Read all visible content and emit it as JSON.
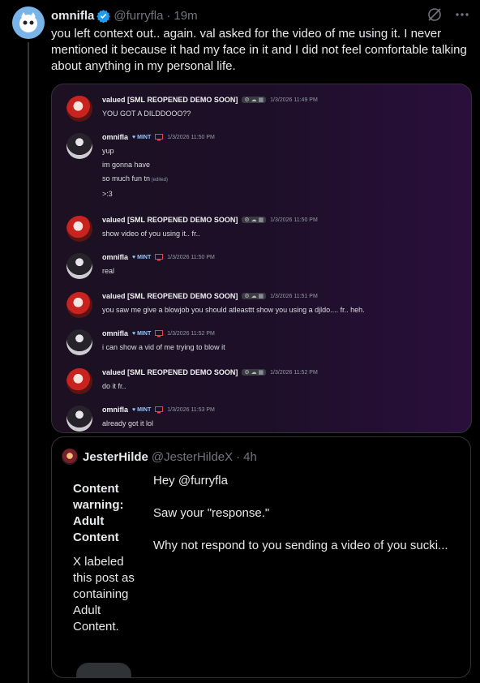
{
  "post": {
    "display_name": "omnifla",
    "handle": "@furryfla",
    "separator": "·",
    "time": "19m",
    "text": "you left context out.. again. val asked for the video of me using it. I never mentioned it because it had my face in it and I did not feel comfortable talking about anything in my personal life."
  },
  "icons": {
    "grok": "grok-icon",
    "more": "more-icon",
    "verified": "verified-badge-icon"
  },
  "colors": {
    "background": "#000000",
    "accent": "#1d9bf0",
    "muted": "#71767b",
    "border": "#2f3336"
  },
  "chat": {
    "messages": [
      {
        "user": "valued [SML REOPENED DEMO SOON]",
        "tag": "⚙ ☁ ▦",
        "time": "1/3/2026 11:49 PM",
        "lines": [
          "YOU GOT A DILDDOOO??"
        ]
      },
      {
        "user": "omnifla",
        "badge": "♥ MINT",
        "time": "1/3/2026 11:50 PM",
        "lines": [
          "yup",
          "im gonna have",
          "so much fun tn",
          ">:3"
        ],
        "edited": "(edited)"
      },
      {
        "user": "valued [SML REOPENED DEMO SOON]",
        "tag": "⚙ ☁ ▦",
        "time": "1/3/2026 11:50 PM",
        "lines": [
          "show video of you using it.. fr.."
        ]
      },
      {
        "user": "omnifla",
        "badge": "♥ MINT",
        "time": "1/3/2026 11:50 PM",
        "lines": [
          "real"
        ]
      },
      {
        "user": "valued [SML REOPENED DEMO SOON]",
        "tag": "⚙ ☁ ▦",
        "time": "1/3/2026 11:51 PM",
        "lines": [
          "you saw me give a blowjob you should atleasttt show you using a djldo.... fr.. heh."
        ]
      },
      {
        "user": "omnifla",
        "badge": "♥ MINT",
        "time": "1/3/2026 11:52 PM",
        "lines": [
          "i can show a vid of me trying to blow it"
        ]
      },
      {
        "user": "valued [SML REOPENED DEMO SOON]",
        "tag": "⚙ ☁ ▦",
        "time": "1/3/2026 11:52 PM",
        "lines": [
          "do it fr.."
        ]
      },
      {
        "user": "omnifla",
        "badge": "♥ MINT",
        "time": "1/3/2026 11:53 PM",
        "lines": [
          "already got it lol"
        ]
      }
    ]
  },
  "quote": {
    "display_name": "JesterHilde",
    "handle": "@JesterHildeX",
    "separator": "·",
    "time": "4h",
    "content_warning_title": "Content warning: Adult Content",
    "content_warning_body": "X labeled this post as containing Adult Content.",
    "text": "Hey @furryfla\n\nSaw your \"response.\"\n\nWhy not respond to you sending a video of you sucki..."
  }
}
